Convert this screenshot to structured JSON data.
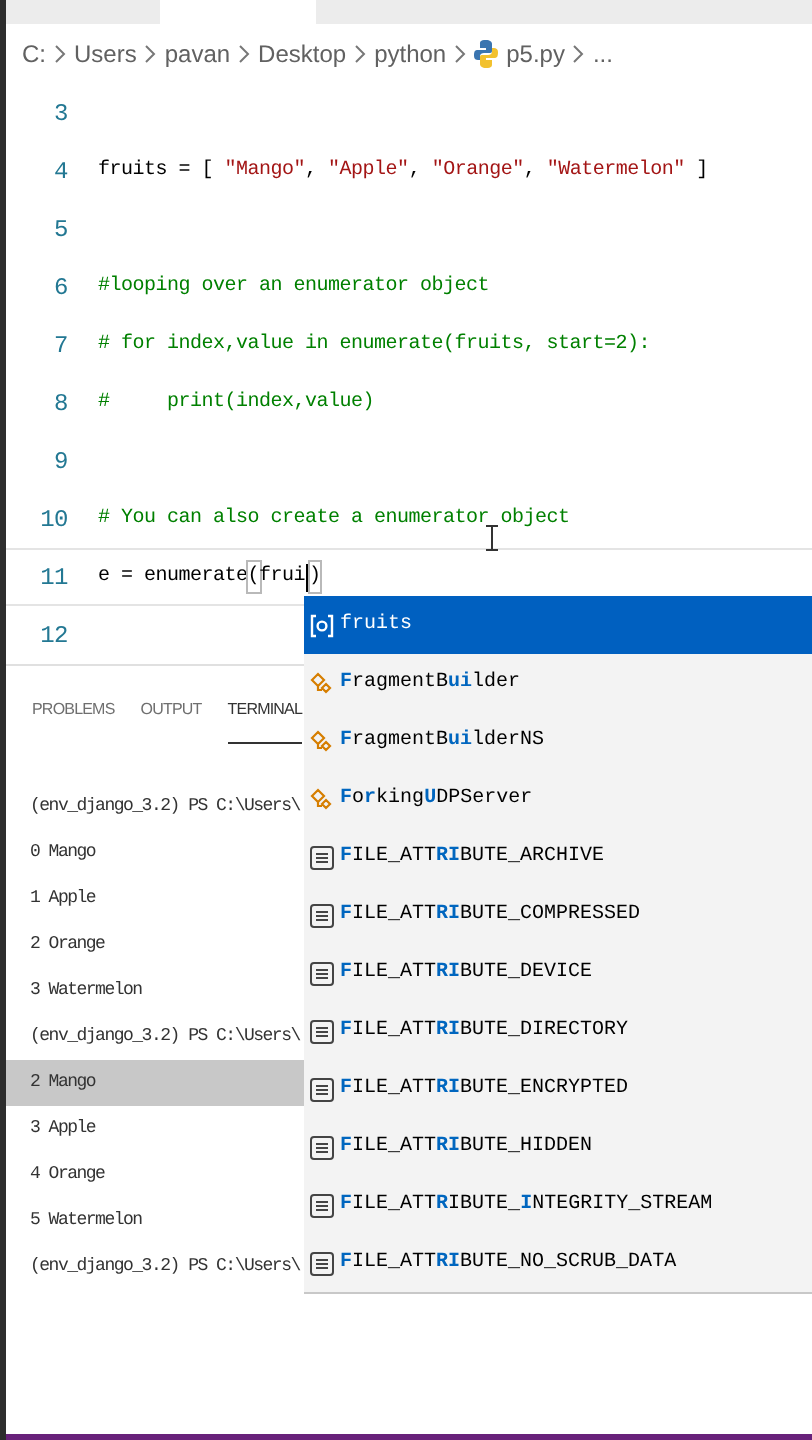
{
  "breadcrumb": {
    "items": [
      {
        "label": "C:",
        "kind": "folder"
      },
      {
        "label": "Users",
        "kind": "folder"
      },
      {
        "label": "pavan",
        "kind": "folder"
      },
      {
        "label": "Desktop",
        "kind": "folder"
      },
      {
        "label": "python",
        "kind": "folder"
      },
      {
        "label": "p5.py",
        "kind": "python-file"
      },
      {
        "label": "...",
        "kind": "folder"
      }
    ]
  },
  "editor": {
    "lines": [
      {
        "number": "3",
        "current": false
      },
      {
        "number": "4",
        "current": false,
        "tokens": [
          {
            "text": "fruits = [ ",
            "kind": "plain"
          },
          {
            "text": "\"Mango\"",
            "kind": "string"
          },
          {
            "text": ", ",
            "kind": "plain"
          },
          {
            "text": "\"Apple\"",
            "kind": "string"
          },
          {
            "text": ", ",
            "kind": "plain"
          },
          {
            "text": "\"Orange\"",
            "kind": "string"
          },
          {
            "text": ", ",
            "kind": "plain"
          },
          {
            "text": "\"Watermelon\"",
            "kind": "string"
          },
          {
            "text": " ]",
            "kind": "plain"
          }
        ]
      },
      {
        "number": "5",
        "current": false
      },
      {
        "number": "6",
        "current": false,
        "tokens": [
          {
            "text": "#looping over an enumerator object",
            "kind": "comment"
          }
        ]
      },
      {
        "number": "7",
        "current": false,
        "tokens": [
          {
            "text": "# for index,value in enumerate(fruits, start=2):",
            "kind": "comment"
          }
        ]
      },
      {
        "number": "8",
        "current": false,
        "tokens": [
          {
            "text": "#     print(index,value)",
            "kind": "comment"
          }
        ]
      },
      {
        "number": "9",
        "current": false
      },
      {
        "number": "10",
        "current": false,
        "tokens": [
          {
            "text": "# You can also create a enumerator object",
            "kind": "comment"
          }
        ]
      },
      {
        "number": "11",
        "current": true,
        "tokens": [
          {
            "text": "e = enumerate",
            "kind": "plain"
          },
          {
            "text": "(",
            "kind": "bracket"
          },
          {
            "text": "frui",
            "kind": "plain"
          },
          {
            "kind": "caret"
          },
          {
            "text": ")",
            "kind": "bracket"
          }
        ]
      },
      {
        "number": "12",
        "current": false
      }
    ]
  },
  "panel": {
    "tabs": [
      {
        "label": "PROBLEMS",
        "selected": false
      },
      {
        "label": "OUTPUT",
        "selected": false
      },
      {
        "label": "TERMINAL",
        "selected": true
      }
    ],
    "terminal_lines": [
      {
        "text": "(env_django_3.2) PS C:\\Users\\",
        "selected": false
      },
      {
        "text": "0 Mango",
        "selected": false
      },
      {
        "text": "1 Apple",
        "selected": false
      },
      {
        "text": "2 Orange",
        "selected": false
      },
      {
        "text": "3 Watermelon",
        "selected": false
      },
      {
        "text": "(env_django_3.2) PS C:\\Users\\",
        "selected": false
      },
      {
        "text": "2 Mango",
        "selected": true
      },
      {
        "text": "3 Apple",
        "selected": false
      },
      {
        "text": "4 Orange",
        "selected": false
      },
      {
        "text": "5 Watermelon",
        "selected": false
      },
      {
        "text": "(env_django_3.2) PS C:\\Users\\",
        "selected": false
      }
    ]
  },
  "suggestions": [
    {
      "kind": "variable",
      "selected": true,
      "label": "fruits"
    },
    {
      "kind": "class",
      "selected": false,
      "label": "**F**ragmentB**ui**lder"
    },
    {
      "kind": "class",
      "selected": false,
      "label": "**F**ragmentB**ui**lderNS"
    },
    {
      "kind": "class",
      "selected": false,
      "label": "**F**o**r**king**U**DPServer"
    },
    {
      "kind": "enum",
      "selected": false,
      "label": "**F**ILE_ATT**RI**BUTE_ARCHIVE"
    },
    {
      "kind": "enum",
      "selected": false,
      "label": "**F**ILE_ATT**RI**BUTE_COMPRESSED"
    },
    {
      "kind": "enum",
      "selected": false,
      "label": "**F**ILE_ATT**RI**BUTE_DEVICE"
    },
    {
      "kind": "enum",
      "selected": false,
      "label": "**F**ILE_ATT**RI**BUTE_DIRECTORY"
    },
    {
      "kind": "enum",
      "selected": false,
      "label": "**F**ILE_ATT**RI**BUTE_ENCRYPTED"
    },
    {
      "kind": "enum",
      "selected": false,
      "label": "**F**ILE_ATT**RI**BUTE_HIDDEN"
    },
    {
      "kind": "enum",
      "selected": false,
      "label": "**F**ILE_ATT**R**IBUTE_**I**NTEGRITY_STREAM"
    },
    {
      "kind": "enum",
      "selected": false,
      "label": "**F**ILE_ATT**RI**BUTE_NO_SCRUB_DATA"
    }
  ]
}
